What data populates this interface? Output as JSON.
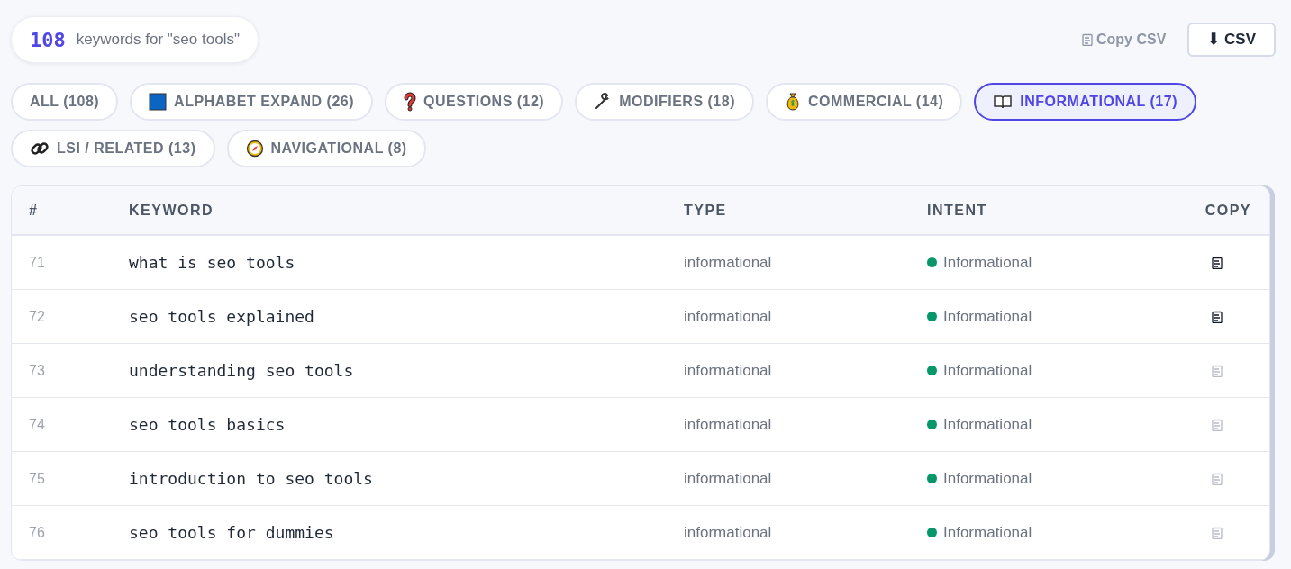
{
  "summary": {
    "count": "108",
    "text": "keywords for \"seo tools\""
  },
  "actions": [
    {
      "kind": "ghost",
      "label": "Copy CSV"
    },
    {
      "kind": "outline",
      "label": "⬇ CSV"
    }
  ],
  "filters": [
    {
      "label": "ALL (108)",
      "selected": false
    },
    {
      "label": "ALPHABET EXPAND (26)",
      "selected": false
    },
    {
      "label": "QUESTIONS (12)",
      "selected": false
    },
    {
      "label": "MODIFIERS (18)",
      "selected": false
    },
    {
      "label": "COMMERCIAL (14)",
      "selected": false
    },
    {
      "label": "INFORMATIONAL (17)",
      "selected": true
    },
    {
      "label": "LSI / RELATED (13)",
      "selected": false
    },
    {
      "label": "NAVIGATIONAL (8)",
      "selected": false
    }
  ],
  "table": {
    "columns": [
      "#",
      "KEYWORD",
      "TYPE",
      "INTENT",
      "COPY"
    ],
    "rows": [
      {
        "number": "71",
        "keyword": "what is seo tools",
        "type": "informational",
        "intent": "Informational",
        "color": "#059669",
        "dimmed": false
      },
      {
        "number": "72",
        "keyword": "seo tools explained",
        "type": "informational",
        "intent": "Informational",
        "color": "#059669",
        "dimmed": false
      },
      {
        "number": "73",
        "keyword": "understanding seo tools",
        "type": "informational",
        "intent": "Informational",
        "color": "#059669",
        "dimmed": true
      },
      {
        "number": "74",
        "keyword": "seo tools basics",
        "type": "informational",
        "intent": "Informational",
        "color": "#059669",
        "dimmed": true
      },
      {
        "number": "75",
        "keyword": "introduction to seo tools",
        "type": "informational",
        "intent": "Informational",
        "color": "#059669",
        "dimmed": true
      },
      {
        "number": "76",
        "keyword": "seo tools for dummies",
        "type": "informational",
        "intent": "Informational",
        "color": "#059669",
        "dimmed": true
      }
    ]
  }
}
